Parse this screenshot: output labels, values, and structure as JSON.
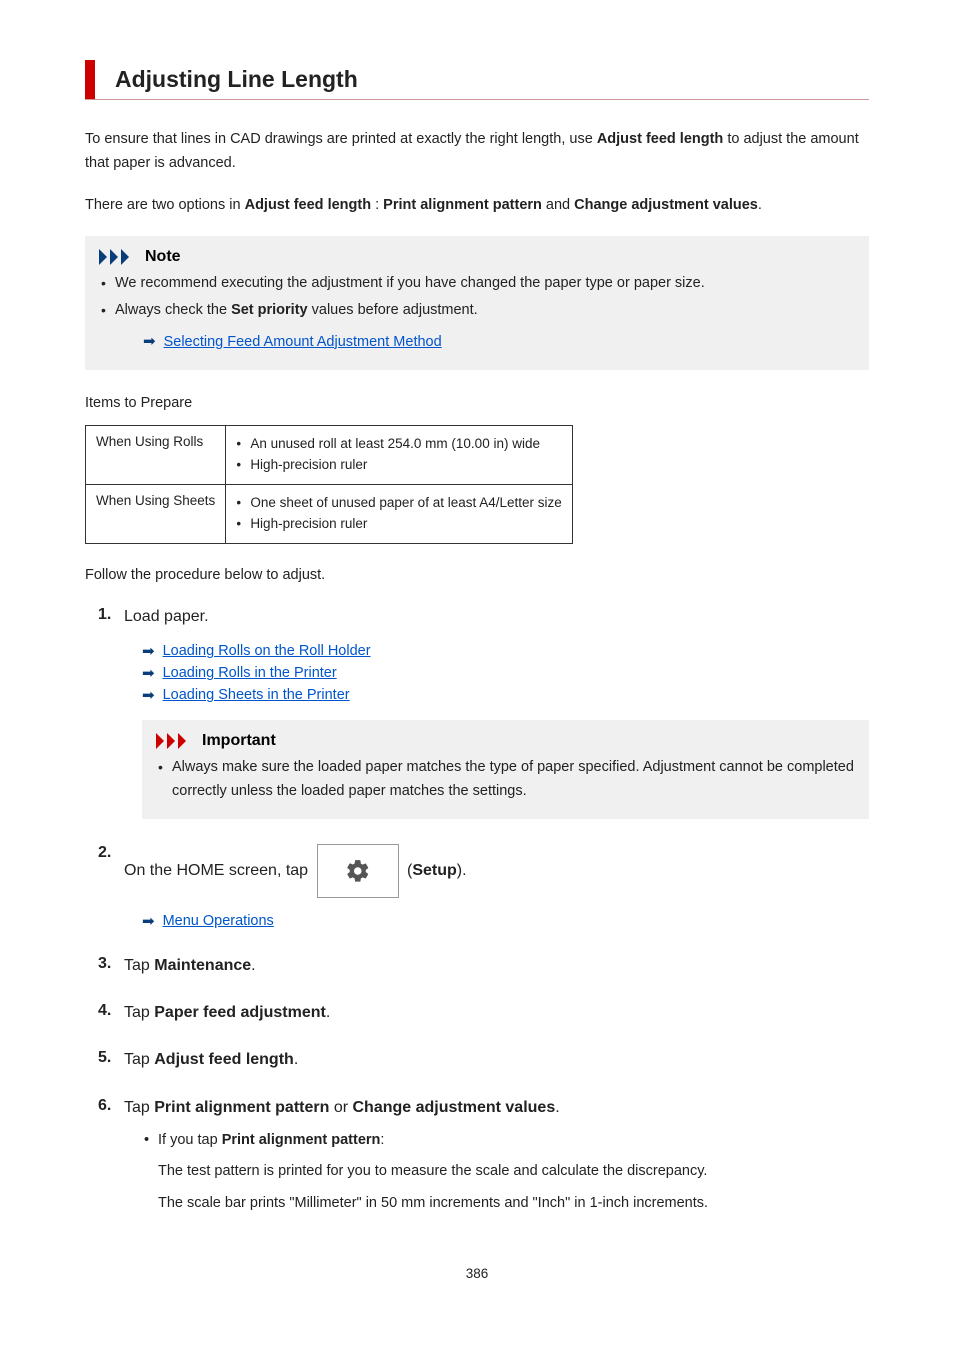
{
  "title": "Adjusting Line Length",
  "intro": {
    "p1_a": "To ensure that lines in CAD drawings are printed at exactly the right length, use ",
    "p1_b": "Adjust feed length",
    "p1_c": " to adjust the amount that paper is advanced.",
    "p2_a": "There are two options in ",
    "p2_b": "Adjust feed length",
    "p2_c": " : ",
    "p2_d": "Print alignment pattern",
    "p2_e": " and ",
    "p2_f": "Change adjustment values",
    "p2_g": "."
  },
  "note": {
    "label": "Note",
    "items": [
      "We recommend executing the adjustment if you have changed the paper type or paper size."
    ],
    "item2_a": "Always check the ",
    "item2_b": "Set priority",
    "item2_c": " values before adjustment.",
    "link": "Selecting Feed Amount Adjustment Method"
  },
  "prepare": {
    "label": "Items to Prepare",
    "rows": [
      {
        "head": "When Using Rolls",
        "items": [
          "An unused roll at least 254.0 mm (10.00 in) wide",
          "High-precision ruler"
        ]
      },
      {
        "head": "When Using Sheets",
        "items": [
          "One sheet of unused paper of at least A4/Letter size",
          "High-precision ruler"
        ]
      }
    ]
  },
  "follow": "Follow the procedure below to adjust.",
  "steps": {
    "s1": {
      "text": "Load paper.",
      "links": [
        "Loading Rolls on the Roll Holder",
        "Loading Rolls in the Printer",
        "Loading Sheets in the Printer"
      ],
      "important_label": "Important",
      "important_item": "Always make sure the loaded paper matches the type of paper specified. Adjustment cannot be completed correctly unless the loaded paper matches the settings."
    },
    "s2": {
      "text_a": "On the HOME screen, tap ",
      "text_b": " (",
      "text_c": "Setup",
      "text_d": ").",
      "link": "Menu Operations"
    },
    "s3": {
      "a": "Tap ",
      "b": "Maintenance",
      "c": "."
    },
    "s4": {
      "a": "Tap ",
      "b": "Paper feed adjustment",
      "c": "."
    },
    "s5": {
      "a": "Tap ",
      "b": "Adjust feed length",
      "c": "."
    },
    "s6": {
      "a": "Tap ",
      "b": "Print alignment pattern",
      "c": " or ",
      "d": "Change adjustment values",
      "e": ".",
      "bullet_a": "If you tap ",
      "bullet_b": "Print alignment pattern",
      "bullet_c": ":",
      "p1": "The test pattern is printed for you to measure the scale and calculate the discrepancy.",
      "p2": "The scale bar prints \"Millimeter\" in 50 mm increments and \"Inch\" in 1-inch increments."
    }
  },
  "page_num": "386"
}
